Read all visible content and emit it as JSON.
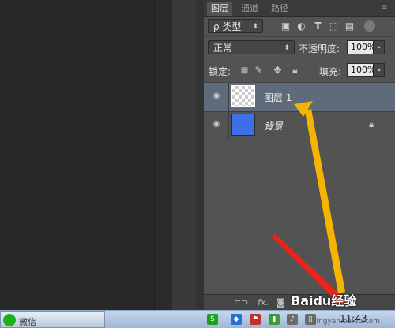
{
  "panel": {
    "tabs": [
      "图层",
      "通道",
      "路径"
    ],
    "filter": {
      "label": "ρ 类型"
    },
    "blend_mode": "正常",
    "opacity_label": "不透明度:",
    "opacity_value": "100%",
    "lock_label": "锁定:",
    "fill_label": "填充:",
    "fill_value": "100%",
    "filter_icons": [
      "image-filter-icon",
      "adjustment-filter-icon",
      "type-filter-icon",
      "shape-filter-icon",
      "smart-object-filter-icon",
      "toggle-filter-icon"
    ],
    "lock_icons": [
      "lock-transparent-icon",
      "lock-image-icon",
      "lock-position-icon",
      "lock-all-icon"
    ]
  },
  "layers": [
    {
      "name": "图层 1",
      "selected": true,
      "thumbnail": "transparent",
      "visible": true,
      "locked": false
    },
    {
      "name": "背景",
      "selected": false,
      "thumbnail": "#3d6fe8",
      "visible": true,
      "locked": true
    }
  ],
  "footer_icons": [
    "link-layers-icon",
    "fx-icon",
    "add-mask-icon"
  ],
  "footer_fx": "fx.",
  "annotations": {
    "arrow_colors": {
      "yellow": "#f5b400",
      "red": "#e8241c"
    }
  },
  "taskbar": {
    "app_label": "微信",
    "clock": "11:43"
  },
  "watermark": {
    "brand": "Baidu经验",
    "url": "jingyan.baidu.com"
  }
}
